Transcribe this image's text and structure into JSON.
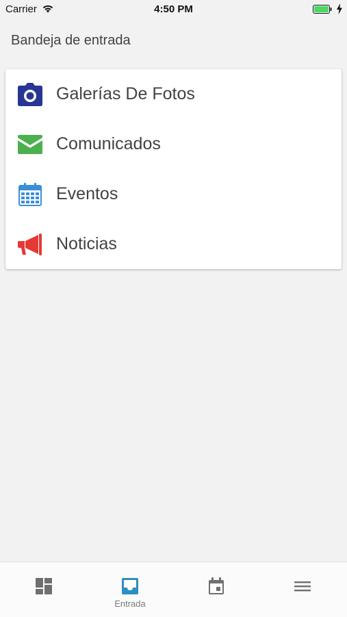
{
  "status_bar": {
    "carrier": "Carrier",
    "time": "4:50 PM"
  },
  "header": {
    "title": "Bandeja de entrada"
  },
  "menu": {
    "items": [
      {
        "label": "Galerías De Fotos",
        "icon": "camera-icon",
        "color": "#283593"
      },
      {
        "label": "Comunicados",
        "icon": "envelope-icon",
        "color": "#4caf50"
      },
      {
        "label": "Eventos",
        "icon": "calendar-icon",
        "color": "#3a8fd8"
      },
      {
        "label": "Noticias",
        "icon": "megaphone-icon",
        "color": "#e53935"
      }
    ]
  },
  "tab_bar": {
    "tabs": [
      {
        "icon": "dashboard-icon",
        "label": "",
        "active": false
      },
      {
        "icon": "inbox-icon",
        "label": "Entrada",
        "active": true
      },
      {
        "icon": "calendar-event-icon",
        "label": "",
        "active": false
      },
      {
        "icon": "menu-icon",
        "label": "",
        "active": false
      }
    ],
    "active_color": "#2b8fc0",
    "inactive_color": "#6f6f6f"
  }
}
